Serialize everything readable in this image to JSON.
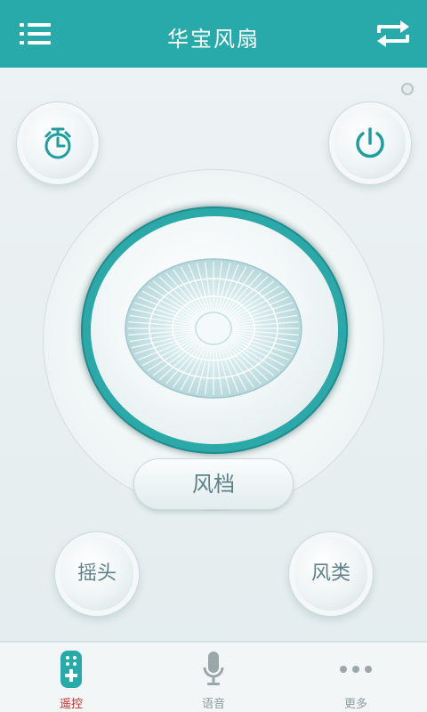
{
  "header": {
    "title": "华宝风扇",
    "menu_icon": "list-menu-icon",
    "switch_icon": "swap-arrows-icon",
    "background": "#27aaa9"
  },
  "controls": {
    "timer_icon": "timer-icon",
    "power_icon": "power-icon",
    "fan_speed_label": "风档",
    "swing_label": "摇头",
    "wind_type_label": "风类",
    "accent": "#2ba8a8"
  },
  "tabbar": {
    "tabs": [
      {
        "label": "遥控",
        "icon": "remote-icon",
        "active": true
      },
      {
        "label": "语音",
        "icon": "microphone-icon",
        "active": false
      },
      {
        "label": "更多",
        "icon": "more-dots-icon",
        "active": false
      }
    ],
    "active_color": "#c92e2e"
  }
}
